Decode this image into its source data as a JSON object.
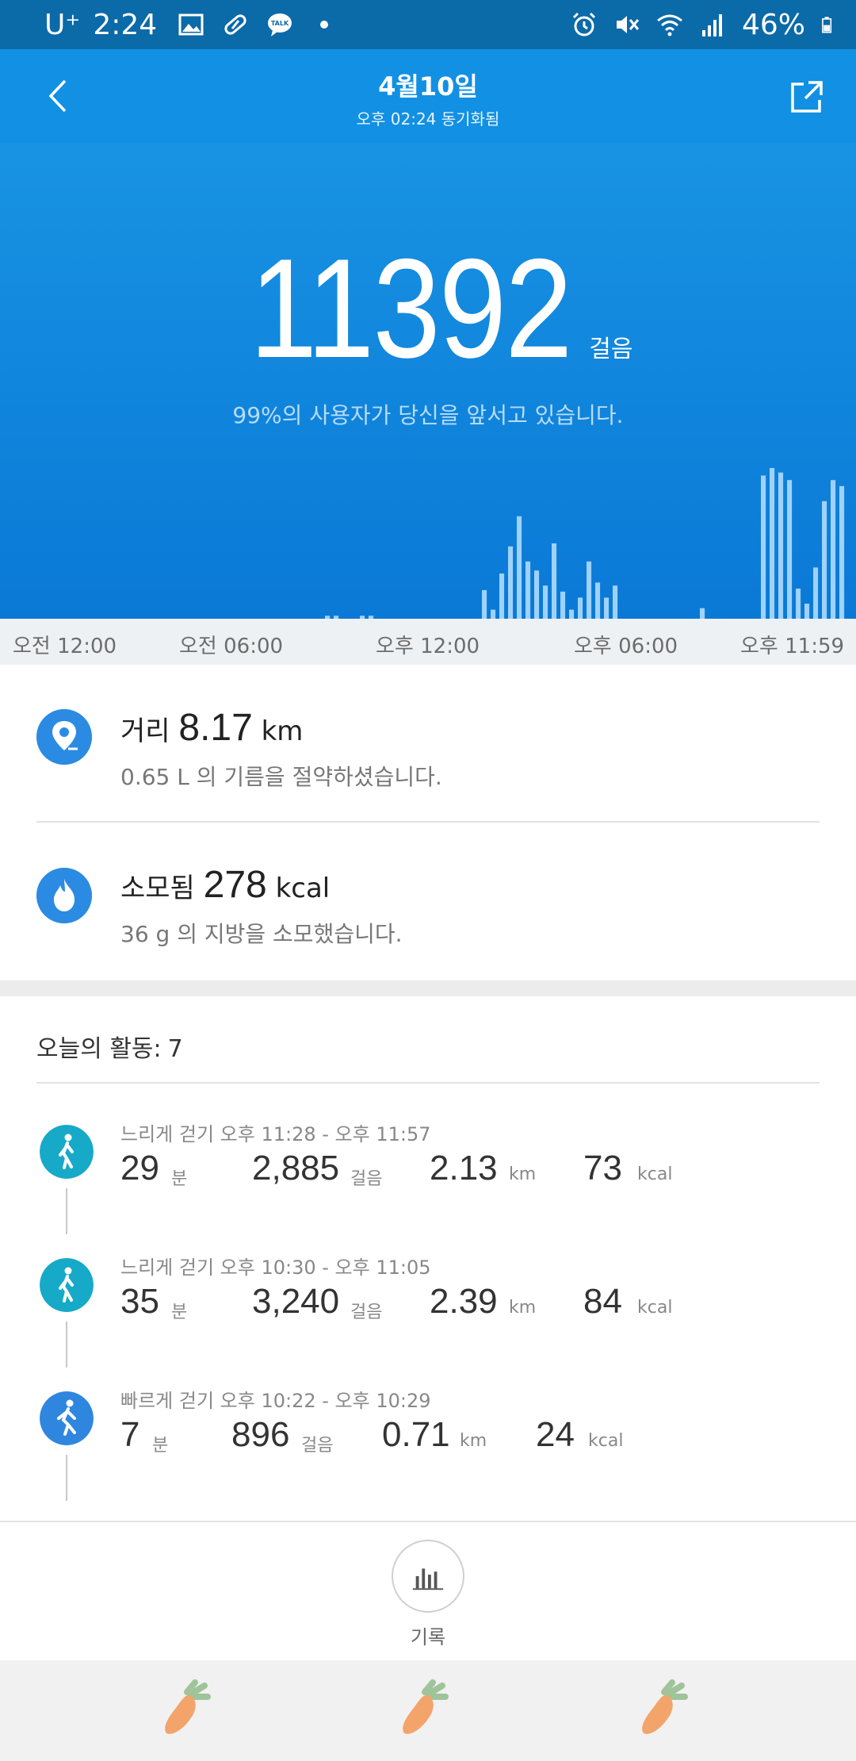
{
  "status_bar": {
    "carrier": "U⁺",
    "time": "2:24",
    "battery": "46%",
    "icons_left": [
      "image-icon",
      "pill-icon",
      "talk-icon",
      "dot-icon"
    ],
    "icons_right": [
      "alarm-icon",
      "mute-icon",
      "wifi-icon",
      "signal-icon",
      "battery-icon"
    ],
    "talk_label": "TALK"
  },
  "header": {
    "title": "4월10일",
    "subtitle": "오후 02:24 동기화됨"
  },
  "hero": {
    "steps": "11392",
    "steps_unit": "걸음",
    "rank_text": "99%의 사용자가 당신을 앞서고 있습니다."
  },
  "histogram": {
    "bar_color": "#9fd2fb",
    "bars_fraction": [
      0.02,
      0.02,
      0.0,
      0.0,
      0.02,
      0.02,
      0.0,
      0.0,
      0.0,
      0.0,
      0.0,
      0.0,
      0.0,
      0.0,
      0.0,
      0.0,
      0.0,
      0.0,
      0.19,
      0.06,
      0.3,
      0.48,
      0.68,
      0.38,
      0.32,
      0.22,
      0.5,
      0.18,
      0.06,
      0.14,
      0.38,
      0.24,
      0.14,
      0.22,
      0.0,
      0.0,
      0.0,
      0.0,
      0.0,
      0.0,
      0.0,
      0.0,
      0.0,
      0.07,
      0.0,
      0.0,
      0.0,
      0.0,
      0.0,
      0.0,
      0.95,
      1.0,
      0.97,
      0.92,
      0.2,
      0.1,
      0.34,
      0.78,
      0.92,
      0.88
    ]
  },
  "axis_labels": [
    "오전 12:00",
    "오전 06:00",
    "오후 12:00",
    "오후 06:00",
    "오후 11:59"
  ],
  "distance": {
    "label": "거리",
    "value": "8.17",
    "unit": "km",
    "sub": "0.65 L 의 기름을 절약하셨습니다."
  },
  "calories": {
    "label": "소모됨",
    "value": "278",
    "unit": "kcal",
    "sub": "36 g 의 지방을 소모했습니다."
  },
  "activities": {
    "title": "오늘의 활동:",
    "count": "7",
    "items": [
      {
        "title": "느리게 걷기 오후 11:28 - 오후 11:57",
        "minutes": "29",
        "min_unit": "분",
        "steps": "2,885",
        "steps_unit": "걸음",
        "distance": "2.13",
        "dist_unit": "km",
        "kcal": "73",
        "kcal_unit": "kcal",
        "color": "#16a9c8"
      },
      {
        "title": "느리게 걷기 오후 10:30 - 오후 11:05",
        "minutes": "35",
        "min_unit": "분",
        "steps": "3,240",
        "steps_unit": "걸음",
        "distance": "2.39",
        "dist_unit": "km",
        "kcal": "84",
        "kcal_unit": "kcal",
        "color": "#16a9c8"
      },
      {
        "title": "빠르게 걷기 오후 10:22 - 오후 10:29",
        "minutes": "7",
        "min_unit": "분",
        "steps": "896",
        "steps_unit": "걸음",
        "distance": "0.71",
        "dist_unit": "km",
        "kcal": "24",
        "kcal_unit": "kcal",
        "color": "#2f86de"
      }
    ]
  },
  "record": {
    "label": "기록"
  },
  "colors": {
    "header": "#1190e4",
    "status_bar": "#0b6aa8",
    "accent": "#2b8be3"
  }
}
